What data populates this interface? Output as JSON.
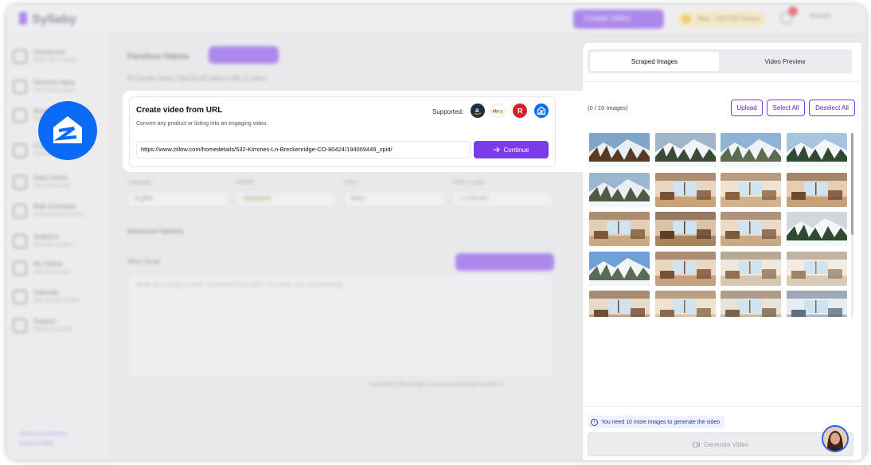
{
  "background": {
    "logo": "Syllaby",
    "create_button": "Create Video",
    "credits": "Max · 100 000 Tokens",
    "user": "Kevin",
    "nav": [
      {
        "t1": "Dashboard",
        "t2": "Quick start & Insights"
      },
      {
        "t1": "Discover Ideas",
        "t2": "Find trending topics"
      },
      {
        "t1": "Brainstorm",
        "t2": "Generate ideas"
      },
      {
        "t1": "Create Videos",
        "t2": "Faceless & avatar"
      },
      {
        "t1": "Video Editor",
        "t2": "Edit videos easily"
      },
      {
        "t1": "Bulk Scheduler",
        "t2": "Schedule videos in bulk"
      },
      {
        "t1": "Analytics",
        "t2": "View your analytics"
      },
      {
        "t1": "My Videos",
        "t2": "View videos here"
      },
      {
        "t1": "Calendar",
        "t2": "View planned content"
      },
      {
        "t1": "Support",
        "t2": "Get quick answers"
      }
    ],
    "footer_links": [
      "Terms & Conditions",
      "Privacy Policy"
    ],
    "heading": "Faceless Videos",
    "tabs": "AI Visuals   Video Clips   B-roll Videos   URL to Video",
    "fields": [
      "Language",
      "Subtitle",
      "Voice",
      "Video Length"
    ],
    "field_values": [
      "English",
      "Highlighted",
      "Brian",
      "1-2 Minutes"
    ],
    "advanced": "Advanced Options",
    "script_label": "Write Script",
    "script_placeholder": "Write your script or click \"Generate from URL\" to create one automatically",
    "footer": "Estimated video length 0 seconds   Estimated Credits 0"
  },
  "url_card": {
    "title": "Create video from URL",
    "subtitle": "Convert any product or listing into an engaging video.",
    "supported_label": "Supported:",
    "platforms": [
      {
        "icon": "amazon-icon",
        "glyph": "a",
        "color": "#232f3e"
      },
      {
        "icon": "ebay-icon",
        "glyph": "ebay",
        "color": "#ffffff"
      },
      {
        "icon": "realtor-icon",
        "glyph": "R",
        "color": "#d21f2b"
      },
      {
        "icon": "zillow-icon",
        "glyph": "",
        "color": "#0a6cf5"
      }
    ],
    "url_value": "https://www.zillow.com/homedetails/532-Kimmes-Ln-Breckenridge-CO-80424/194069449_zpid/",
    "continue_label": "Continue"
  },
  "panel": {
    "tabs": [
      {
        "label": "Scraped Images",
        "active": true
      },
      {
        "label": "Video Preview",
        "active": false
      }
    ],
    "image_count": "(0 / 10 Images)",
    "upload_label": "Upload",
    "select_all_label": "Select All",
    "deselect_all_label": "Deselect All",
    "notice": "You need 10 more images to generate the video",
    "generate_label": "Generate Video",
    "images": [
      {
        "alt": "cabin-exterior-winter"
      },
      {
        "alt": "snowy-cabin-trees"
      },
      {
        "alt": "mountain-valley-view"
      },
      {
        "alt": "snowy-pine-forest"
      },
      {
        "alt": "mountain-ski-slopes"
      },
      {
        "alt": "kitchen-wood-cabinets"
      },
      {
        "alt": "kitchen-island"
      },
      {
        "alt": "dining-room"
      },
      {
        "alt": "living-room-windows"
      },
      {
        "alt": "living-room-fireplace"
      },
      {
        "alt": "great-room-loft"
      },
      {
        "alt": "forest-snow-view"
      },
      {
        "alt": "mountain-peak-view"
      },
      {
        "alt": "hallway-doors"
      },
      {
        "alt": "bathroom-vanity"
      },
      {
        "alt": "bathroom-mirror"
      },
      {
        "alt": "bedroom-lamp"
      },
      {
        "alt": "staircase"
      },
      {
        "alt": "bedroom-window"
      },
      {
        "alt": "bedroom-blue"
      }
    ]
  }
}
